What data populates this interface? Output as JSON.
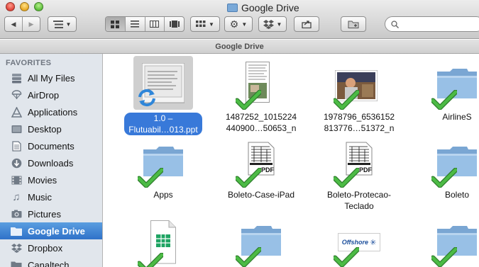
{
  "window": {
    "title": "Google Drive"
  },
  "toolbar": {
    "back_glyph": "◀",
    "forward_glyph": "▶",
    "arrange_icon": "list-arrange-icon",
    "view_icons": [
      "icon-view-icon",
      "list-view-icon",
      "column-view-icon",
      "coverflow-view-icon"
    ],
    "action_icon": "gear-icon",
    "dropbox_icon": "dropbox-icon",
    "share_icon": "share-icon",
    "new_folder_icon": "new-folder-icon",
    "search_placeholder": ""
  },
  "pathbar": {
    "title": "Google Drive"
  },
  "sidebar": {
    "header": "FAVORITES",
    "items": [
      {
        "label": "All My Files",
        "icon": "all-files-icon"
      },
      {
        "label": "AirDrop",
        "icon": "airdrop-icon"
      },
      {
        "label": "Applications",
        "icon": "applications-icon"
      },
      {
        "label": "Desktop",
        "icon": "desktop-icon"
      },
      {
        "label": "Documents",
        "icon": "documents-icon"
      },
      {
        "label": "Downloads",
        "icon": "downloads-icon"
      },
      {
        "label": "Movies",
        "icon": "movies-icon"
      },
      {
        "label": "Music",
        "icon": "music-icon"
      },
      {
        "label": "Pictures",
        "icon": "pictures-icon"
      },
      {
        "label": "Google Drive",
        "icon": "google-drive-folder-icon",
        "selected": true
      },
      {
        "label": "Dropbox",
        "icon": "dropbox-icon"
      },
      {
        "label": "Canaltech",
        "icon": "folder-icon"
      }
    ]
  },
  "files": [
    {
      "name": "1.0 –\nFlutuabil…013.ppt",
      "kind": "presentation",
      "status": "syncing",
      "selected": true
    },
    {
      "name": "1487252_1015224\n440900…50653_n",
      "kind": "image-document",
      "status": "synced"
    },
    {
      "name": "1978796_6536152\n813776…51372_n",
      "kind": "photo",
      "status": "synced"
    },
    {
      "name": "AirlineS",
      "kind": "folder",
      "status": "synced"
    },
    {
      "name": "Apps",
      "kind": "folder",
      "status": "synced"
    },
    {
      "name": "Boleto-Case-iPad",
      "kind": "pdf",
      "status": "synced"
    },
    {
      "name": "Boleto-Protecao-\nTeclado",
      "kind": "pdf",
      "status": "synced"
    },
    {
      "name": "Boleto",
      "kind": "folder",
      "status": "synced"
    },
    {
      "name": "",
      "kind": "spreadsheet",
      "status": "synced"
    },
    {
      "name": "",
      "kind": "folder",
      "status": "synced"
    },
    {
      "name": "",
      "kind": "offshore-image",
      "status": "synced",
      "logo_text": "Offshore"
    },
    {
      "name": "",
      "kind": "folder",
      "status": "synced"
    }
  ],
  "colors": {
    "selection": "#3879d9",
    "sidebar_bg": "#e1e6ec",
    "check_green": "#3aa637",
    "folder_blue": "#8fb8e0"
  }
}
